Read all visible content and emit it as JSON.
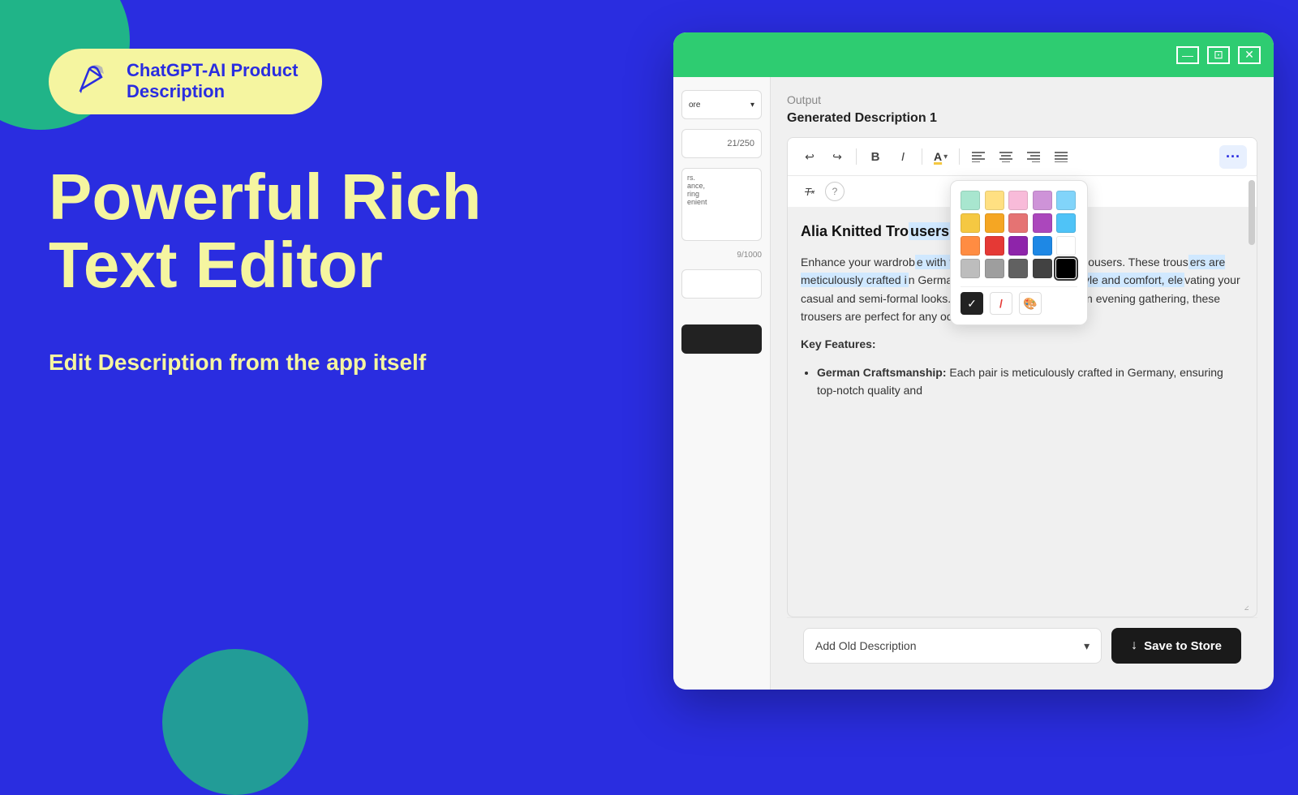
{
  "background": {
    "color": "#2a2de0"
  },
  "logo": {
    "text_line1": "ChatGPT-AI Product",
    "text_line2": "Description",
    "icon": "✏"
  },
  "headline": {
    "line1": "Powerful Rich",
    "line2": "Text Editor"
  },
  "subtext": "Edit Description from the app itself",
  "window": {
    "title": "ChatGPT AI Product Description",
    "controls": {
      "minimize": "—",
      "maximize": "⊡",
      "close": "✕"
    },
    "titlebar_color": "#2ecc71"
  },
  "output_section": {
    "label": "Output",
    "description_title": "Generated Description 1"
  },
  "editor": {
    "content_title": "Alia Knitted Tro",
    "content_body": "Enhance your wardrob",
    "content_full": "Enhance your wardrobe with the exquisite Alia Knitted Trousers. These trousers are meticulously crafted in Germany, effortlessly combine style and comfort, elevating your casual and semi-formal looks. Whether it's a day out or an evening gathering, these trousers are perfect for any occasion.",
    "key_features_label": "Key Features:",
    "feature1_title": "German Craftsmanship:",
    "feature1_text": "Each pair is meticulously crafted in Germany, ensuring top-notch quality and"
  },
  "toolbar": {
    "undo": "↩",
    "redo": "↪",
    "bold": "B",
    "italic": "I",
    "align_left": "≡",
    "align_center": "≡",
    "align_right": "≡",
    "justify": "≡",
    "more": "..."
  },
  "color_picker": {
    "colors": [
      "#a8e6cf",
      "#ffe082",
      "#f8bbd9",
      "#b39ddb",
      "#81d4fa",
      "#f5c842",
      "#f5a623",
      "#e57373",
      "#ce93d8",
      "#4fc3f7",
      "#ff8c42",
      "#e53935",
      "#8e24aa",
      "#1e88e5",
      "#ffffff",
      "#9e9e9e",
      "#757575",
      "#424242",
      "#212121",
      "#000000"
    ],
    "selected_color": "#000000",
    "actions": {
      "confirm": "✓",
      "erase": "/",
      "palette": "🎨"
    }
  },
  "form_sidebar": {
    "counter": "21/250",
    "textarea_counter": "9/1000"
  },
  "bottom_bar": {
    "dropdown_label": "Add Old Description",
    "save_button": "Save to Store",
    "save_icon": "↓"
  }
}
